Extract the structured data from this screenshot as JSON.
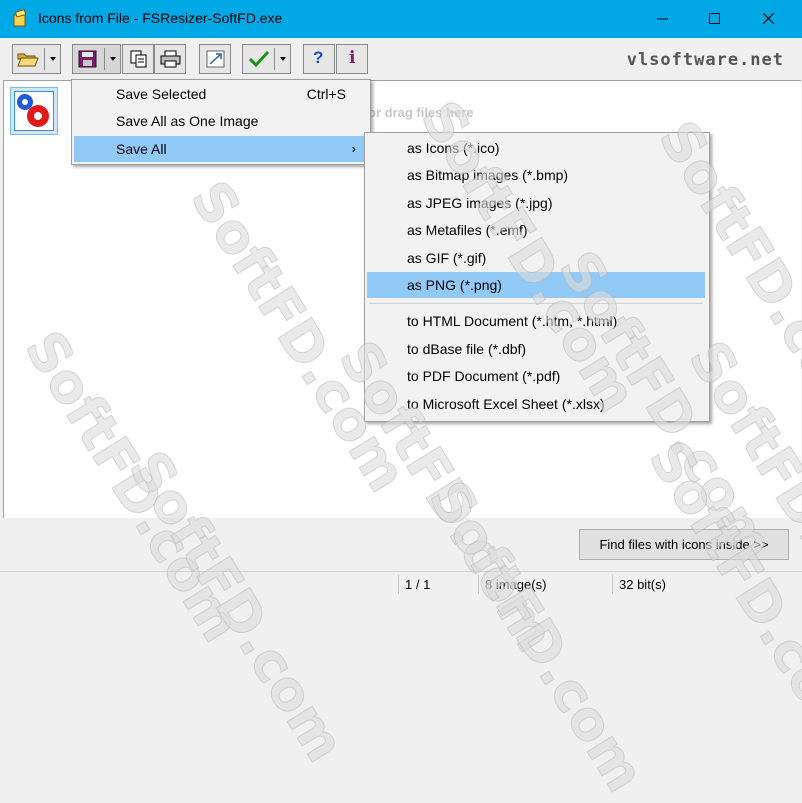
{
  "window": {
    "title": "Icons from File - FSResizer-SoftFD.exe"
  },
  "toolbar": {
    "buttons": [
      {
        "name": "open-button",
        "icon": "folder-open-icon"
      },
      {
        "name": "save-button",
        "icon": "floppy-disk-icon"
      },
      {
        "name": "copy-button",
        "icon": "copy-icon"
      },
      {
        "name": "print-button",
        "icon": "printer-icon"
      },
      {
        "name": "resize-button",
        "icon": "resize-icon"
      },
      {
        "name": "check-button",
        "icon": "checkmark-icon"
      },
      {
        "name": "help-button",
        "icon": "help-icon",
        "glyph": "?"
      },
      {
        "name": "info-button",
        "icon": "info-icon",
        "glyph": "i"
      }
    ],
    "site": "vlsoftware.net"
  },
  "workspace": {
    "drop_hint": "or drag files here"
  },
  "save_menu": {
    "items": [
      {
        "label": "Save Selected",
        "shortcut": "Ctrl+S"
      },
      {
        "label": "Save All as One Image",
        "shortcut": ""
      },
      {
        "label": "Save All",
        "shortcut": "",
        "submenu_arrow": "›",
        "highlighted": true
      }
    ]
  },
  "save_all_submenu": {
    "group1": [
      "as Icons (*.ico)",
      "as Bitmap images (*.bmp)",
      "as JPEG images (*.jpg)",
      "as Metafiles (*.emf)",
      "as GIF (*.gif)",
      "as PNG (*.png)"
    ],
    "group2": [
      "to HTML Document (*.htm, *.html)",
      "to dBase file (*.dbf)",
      "to PDF Document (*.pdf)",
      "to Microsoft Excel Sheet (*.xlsx)"
    ],
    "highlighted": "as PNG (*.png)"
  },
  "find_button": {
    "label": "Find files with icons inside >>"
  },
  "status": {
    "page": "1 / 1",
    "count": "8 image(s)",
    "bits": "32 bit(s)"
  },
  "watermark": {
    "text": "SoftFD.com"
  },
  "colors": {
    "titlebar": "#00a8e6",
    "highlight": "#91c9f7",
    "menu_bg": "#f2f2f2"
  }
}
